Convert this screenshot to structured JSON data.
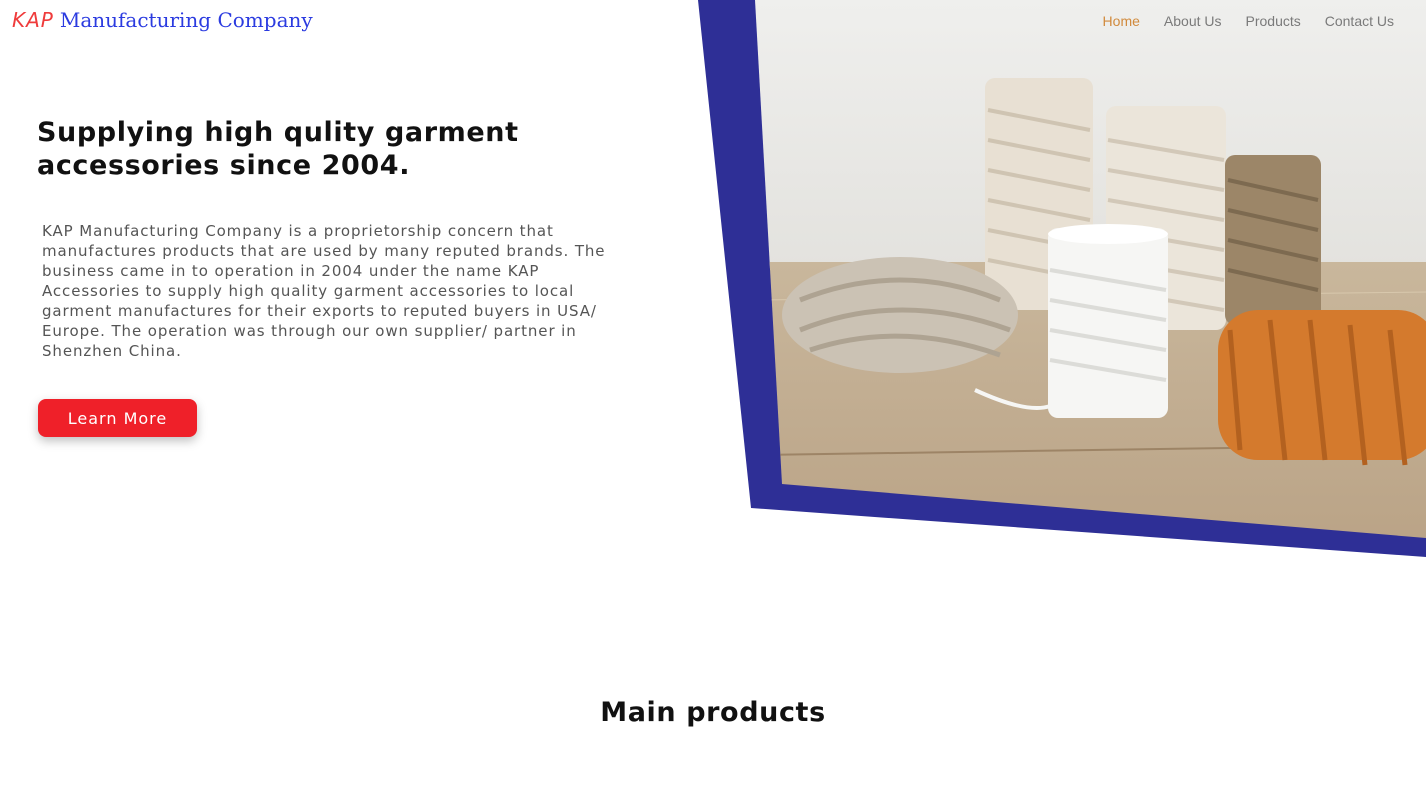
{
  "brand": {
    "kap": "KAP",
    "name": "Manufacturing Company"
  },
  "nav": {
    "items": [
      {
        "label": "Home",
        "active": true
      },
      {
        "label": "About Us",
        "active": false
      },
      {
        "label": "Products",
        "active": false
      },
      {
        "label": "Contact Us",
        "active": false
      }
    ]
  },
  "hero": {
    "headline": "Supplying high qulity garment accessories since 2004.",
    "description": "KAP Manufacturing Company is a proprietorship concern that manufactures products that are used by many reputed brands. The business came in to operation in 2004 under the name KAP Accessories to supply high quality garment accessories to local garment manufactures for their exports to reputed buyers in USA/ Europe. The operation was through our own supplier/ partner in Shenzhen China.",
    "cta_label": "Learn More",
    "image_subject": "cotton cord spools"
  },
  "sections": {
    "main_products_title": "Main products"
  },
  "colors": {
    "brand_red": "#ef3b3b",
    "brand_blue": "#2b3be0",
    "frame_navy": "#2e2f96",
    "nav_active": "#d18a3c",
    "button_red": "#ef2029"
  }
}
